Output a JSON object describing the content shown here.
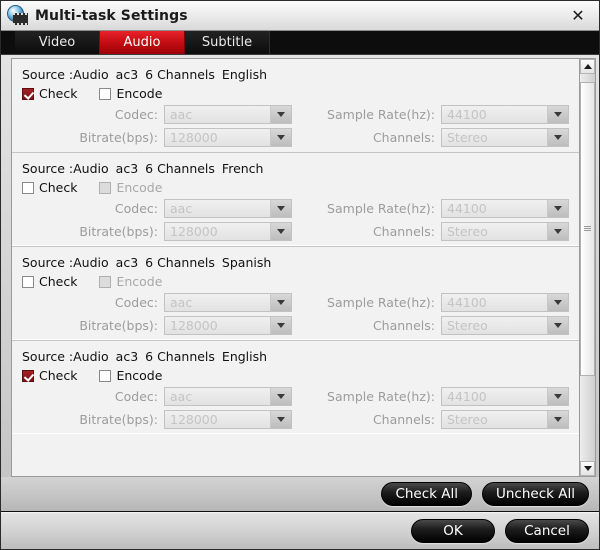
{
  "window": {
    "title": "Multi-task Settings",
    "app_icon": "disc-film-icon",
    "close_label": "✕"
  },
  "tabs": [
    {
      "label": "Video",
      "active": false
    },
    {
      "label": "Audio",
      "active": true
    },
    {
      "label": "Subtitle",
      "active": false
    }
  ],
  "labels": {
    "check": "Check",
    "encode": "Encode",
    "codec": "Codec:",
    "sample_rate": "Sample Rate(hz):",
    "bitrate": "Bitrate(bps):",
    "channels": "Channels:",
    "source_prefix": "Source :Audio"
  },
  "tracks": [
    {
      "source_prefix": "Source :Audio",
      "format": "ac3",
      "channels_desc": "6 Channels",
      "language": "English",
      "checked": true,
      "encode_checked": false,
      "encode_enabled": true,
      "codec": "aac",
      "sample_rate": "44100",
      "bitrate": "128000",
      "channels": "Stereo"
    },
    {
      "source_prefix": "Source :Audio",
      "format": "ac3",
      "channels_desc": "6 Channels",
      "language": "French",
      "checked": false,
      "encode_checked": false,
      "encode_enabled": false,
      "codec": "aac",
      "sample_rate": "44100",
      "bitrate": "128000",
      "channels": "Stereo"
    },
    {
      "source_prefix": "Source :Audio",
      "format": "ac3",
      "channels_desc": "6 Channels",
      "language": "Spanish",
      "checked": false,
      "encode_checked": false,
      "encode_enabled": false,
      "codec": "aac",
      "sample_rate": "44100",
      "bitrate": "128000",
      "channels": "Stereo"
    },
    {
      "source_prefix": "Source :Audio",
      "format": "ac3",
      "channels_desc": "6 Channels",
      "language": "English",
      "checked": true,
      "encode_checked": false,
      "encode_enabled": true,
      "codec": "aac",
      "sample_rate": "44100",
      "bitrate": "128000",
      "channels": "Stereo"
    }
  ],
  "buttons": {
    "check_all": "Check All",
    "uncheck_all": "Uncheck All",
    "ok": "OK",
    "cancel": "Cancel"
  },
  "scrollbar": {
    "thumb_top_pct": 2,
    "thumb_height_pct": 76
  },
  "colors": {
    "accent_red": "#c30d13",
    "checkbox_red": "#8d181c",
    "panel_bg": "#f2f2f2",
    "disabled_text": "#c4c4c4",
    "label_text": "#9c9c9c"
  }
}
